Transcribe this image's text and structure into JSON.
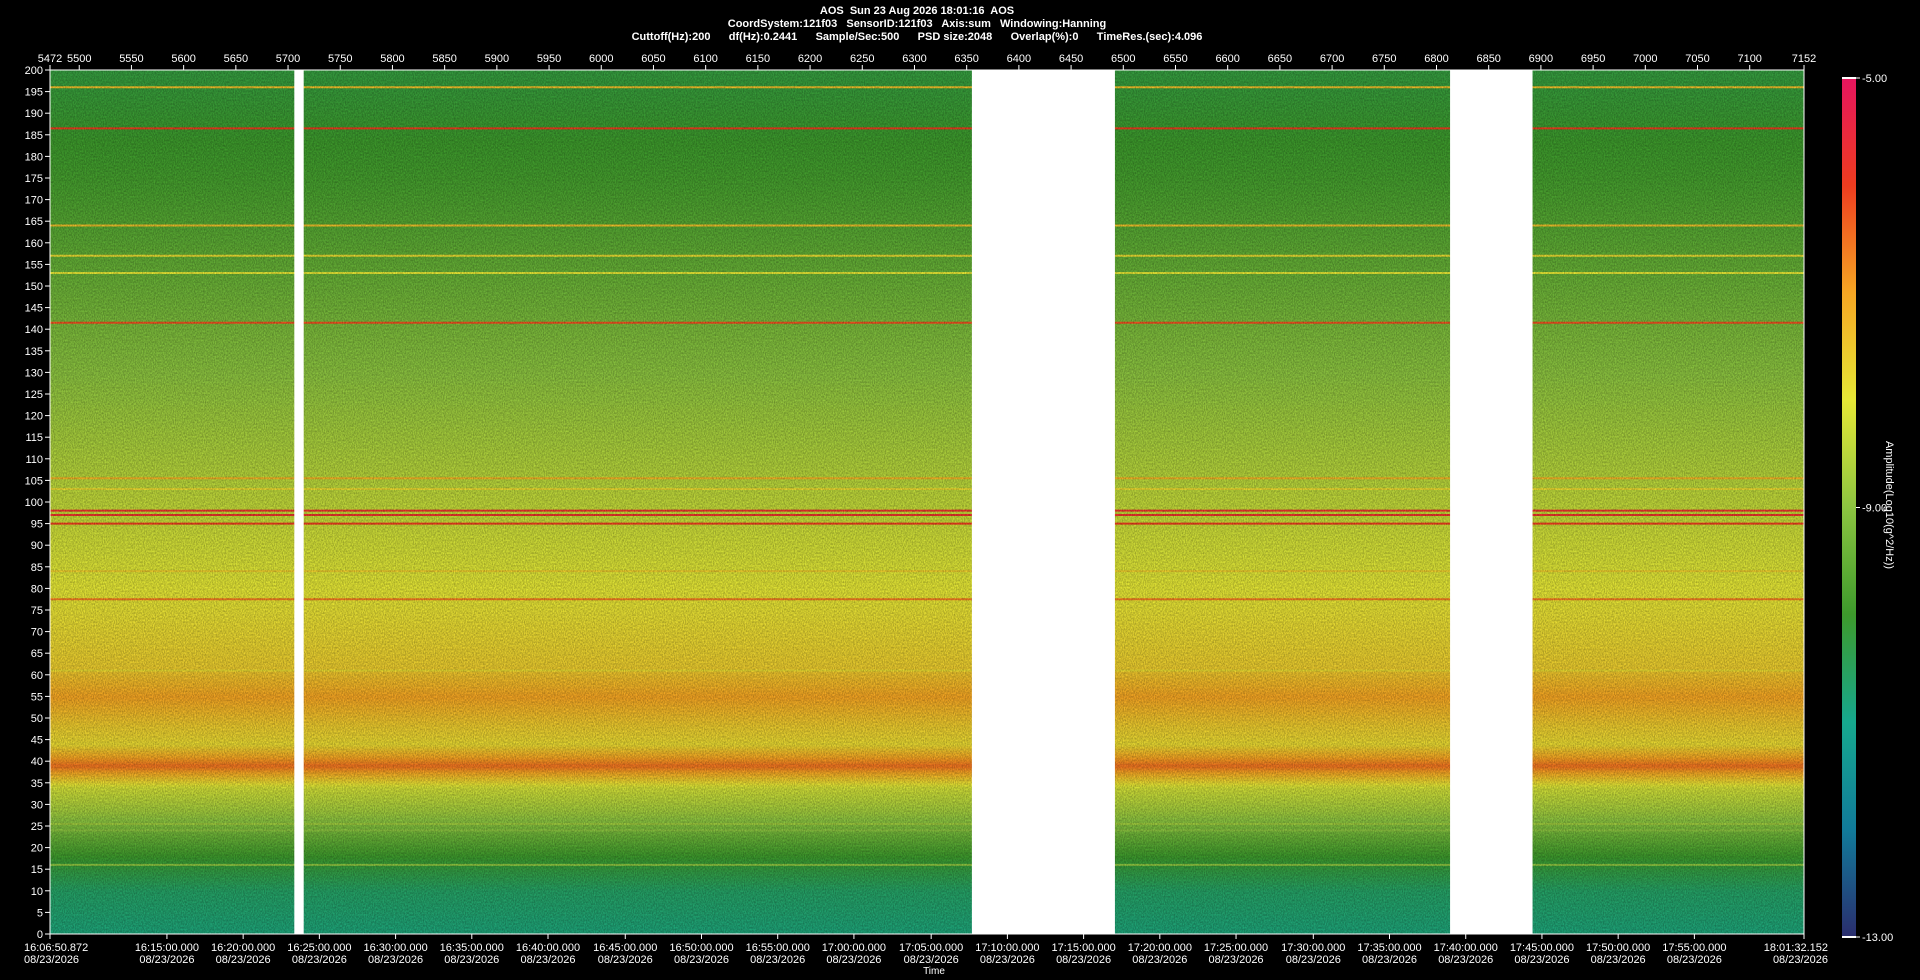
{
  "header": {
    "line1": "AOS  Sun 23 Aug 2026 18:01:16  AOS",
    "line2": "CoordSystem:121f03   SensorID:121f03   Axis:sum   Windowing:Hanning",
    "line3": "Cuttoff(Hz):200      df(Hz):0.2441      Sample/Sec:500      PSD size:2048      Overlap(%):0      TimeRes.(sec):4.096"
  },
  "chart_data": {
    "type": "heatmap",
    "title": "",
    "xlabel": "Time",
    "ylabel": "",
    "y_unit": "Hz",
    "ylim": [
      0,
      200
    ],
    "y_ticks": [
      0,
      5,
      10,
      15,
      20,
      25,
      30,
      35,
      40,
      45,
      50,
      55,
      60,
      65,
      70,
      75,
      80,
      85,
      90,
      95,
      100,
      105,
      110,
      115,
      120,
      125,
      130,
      135,
      140,
      145,
      150,
      155,
      160,
      165,
      170,
      175,
      180,
      185,
      190,
      195,
      200
    ],
    "top_axis": {
      "range": [
        5472,
        7152
      ],
      "ticks": [
        5472,
        5500,
        5550,
        5600,
        5650,
        5700,
        5750,
        5800,
        5850,
        5900,
        5950,
        6000,
        6050,
        6100,
        6150,
        6200,
        6250,
        6300,
        6350,
        6400,
        6450,
        6500,
        6550,
        6600,
        6650,
        6700,
        6750,
        6800,
        6850,
        6900,
        6950,
        7000,
        7050,
        7100,
        7152
      ]
    },
    "bottom_axis": {
      "ticks": [
        {
          "pos": 5472,
          "time": "16:06:50.872",
          "date": "08/23/2026"
        },
        {
          "pos": 5584,
          "time": "16:15:00.000",
          "date": "08/23/2026"
        },
        {
          "pos": 5657,
          "time": "16:20:00.000",
          "date": "08/23/2026"
        },
        {
          "pos": 5730,
          "time": "16:25:00.000",
          "date": "08/23/2026"
        },
        {
          "pos": 5803,
          "time": "16:30:00.000",
          "date": "08/23/2026"
        },
        {
          "pos": 5876,
          "time": "16:35:00.000",
          "date": "08/23/2026"
        },
        {
          "pos": 5949,
          "time": "16:40:00.000",
          "date": "08/23/2026"
        },
        {
          "pos": 6023,
          "time": "16:45:00.000",
          "date": "08/23/2026"
        },
        {
          "pos": 6096,
          "time": "16:50:00.000",
          "date": "08/23/2026"
        },
        {
          "pos": 6169,
          "time": "16:55:00.000",
          "date": "08/23/2026"
        },
        {
          "pos": 6242,
          "time": "17:00:00.000",
          "date": "08/23/2026"
        },
        {
          "pos": 6316,
          "time": "17:05:00.000",
          "date": "08/23/2026"
        },
        {
          "pos": 6389,
          "time": "17:10:00.000",
          "date": "08/23/2026"
        },
        {
          "pos": 6462,
          "time": "17:15:00.000",
          "date": "08/23/2026"
        },
        {
          "pos": 6535,
          "time": "17:20:00.000",
          "date": "08/23/2026"
        },
        {
          "pos": 6608,
          "time": "17:25:00.000",
          "date": "08/23/2026"
        },
        {
          "pos": 6682,
          "time": "17:30:00.000",
          "date": "08/23/2026"
        },
        {
          "pos": 6755,
          "time": "17:35:00.000",
          "date": "08/23/2026"
        },
        {
          "pos": 6828,
          "time": "17:40:00.000",
          "date": "08/23/2026"
        },
        {
          "pos": 6901,
          "time": "17:45:00.000",
          "date": "08/23/2026"
        },
        {
          "pos": 6974,
          "time": "17:50:00.000",
          "date": "08/23/2026"
        },
        {
          "pos": 7047,
          "time": "17:55:00.000",
          "date": "08/23/2026"
        },
        {
          "pos": 7152,
          "time": "18:01:32.152",
          "date": "08/23/2026"
        }
      ]
    },
    "data_gaps": [
      [
        5706,
        5715
      ],
      [
        6355,
        6492
      ],
      [
        6813,
        6892
      ]
    ],
    "base_spectrum": [
      {
        "hz": 0,
        "amp": -10.8
      },
      {
        "hz": 10,
        "amp": -10.6
      },
      {
        "hz": 18,
        "amp": -10.0
      },
      {
        "hz": 23,
        "amp": -9.4
      },
      {
        "hz": 28,
        "amp": -8.8
      },
      {
        "hz": 34,
        "amp": -8.2
      },
      {
        "hz": 39,
        "amp": -6.5
      },
      {
        "hz": 44,
        "amp": -7.8
      },
      {
        "hz": 48,
        "amp": -7.6
      },
      {
        "hz": 55,
        "amp": -7.0
      },
      {
        "hz": 62,
        "amp": -7.6
      },
      {
        "hz": 75,
        "amp": -7.9
      },
      {
        "hz": 90,
        "amp": -8.2
      },
      {
        "hz": 110,
        "amp": -8.6
      },
      {
        "hz": 130,
        "amp": -9.0
      },
      {
        "hz": 150,
        "amp": -9.4
      },
      {
        "hz": 175,
        "amp": -9.9
      },
      {
        "hz": 200,
        "amp": -10.2
      }
    ],
    "tonal_lines": [
      {
        "hz": 196,
        "amp": -7.4
      },
      {
        "hz": 186.5,
        "amp": -6.0
      },
      {
        "hz": 164,
        "amp": -7.4
      },
      {
        "hz": 157,
        "amp": -7.8
      },
      {
        "hz": 153,
        "amp": -8.0
      },
      {
        "hz": 141.5,
        "amp": -6.2
      },
      {
        "hz": 105.5,
        "amp": -7.2
      },
      {
        "hz": 103,
        "amp": -7.8
      },
      {
        "hz": 98,
        "amp": -5.8
      },
      {
        "hz": 97,
        "amp": -5.8
      },
      {
        "hz": 95,
        "amp": -6.0
      },
      {
        "hz": 84,
        "amp": -7.6
      },
      {
        "hz": 77.5,
        "amp": -6.6
      },
      {
        "hz": 61,
        "amp": -7.8
      },
      {
        "hz": 25.5,
        "amp": -8.8
      },
      {
        "hz": 24,
        "amp": -9.0
      },
      {
        "hz": 16,
        "amp": -9.0
      }
    ],
    "colorbar": {
      "label": "Amplitude(Log10(g^2/Hz))",
      "min": -13.0,
      "mid": -9.0,
      "max": -5.0,
      "min_label": "-13.00",
      "mid_label": "-9.00",
      "max_label": "-5.00",
      "colors": [
        "#2a2d6e",
        "#117b9a",
        "#16a88e",
        "#3d9a2c",
        "#8cc440",
        "#e6e836",
        "#f6a623",
        "#ee3c1f",
        "#e6155e"
      ]
    }
  }
}
